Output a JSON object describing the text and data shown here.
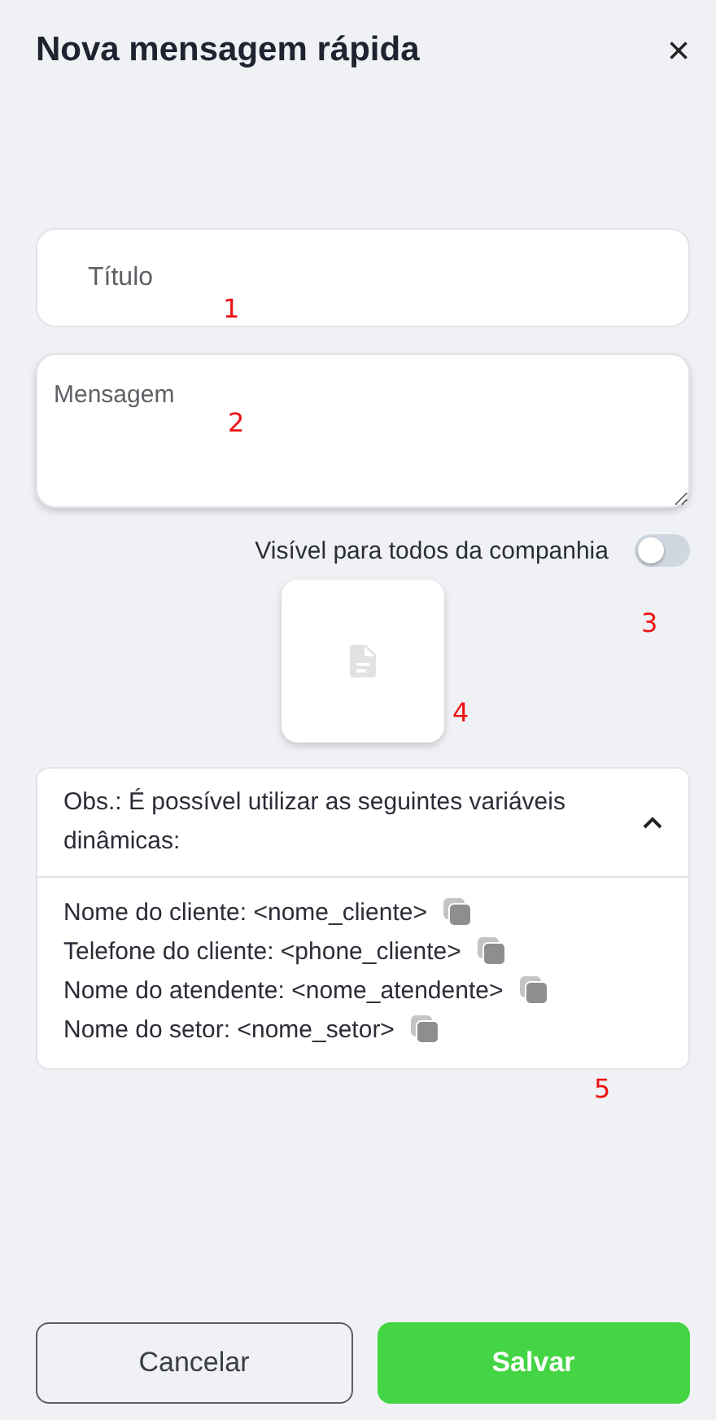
{
  "dialog": {
    "title": "Nova mensagem rápida",
    "close_icon": "×"
  },
  "title_field": {
    "placeholder": "Título"
  },
  "message_field": {
    "placeholder": "Mensagem"
  },
  "visibility_toggle": {
    "label": "Visível para todos da companhia",
    "on": false
  },
  "attachment": {
    "kind": "file"
  },
  "variables_panel": {
    "heading": "Obs.: É possível utilizar as seguintes variáveis dinâmicas:",
    "expanded": true,
    "items": [
      {
        "text": "Nome do cliente: <nome_cliente>"
      },
      {
        "text": "Telefone do cliente: <phone_cliente>"
      },
      {
        "text": "Nome do atendente: <nome_atendente>"
      },
      {
        "text": "Nome do setor: <nome_setor>"
      }
    ]
  },
  "buttons": [
    {
      "label": "Cancelar",
      "kind": "secondary"
    },
    {
      "label": "Salvar",
      "kind": "primary"
    }
  ],
  "annotations": [
    {
      "label": "1"
    },
    {
      "label": "2"
    },
    {
      "label": "3"
    },
    {
      "label": "4"
    },
    {
      "label": "5"
    }
  ]
}
